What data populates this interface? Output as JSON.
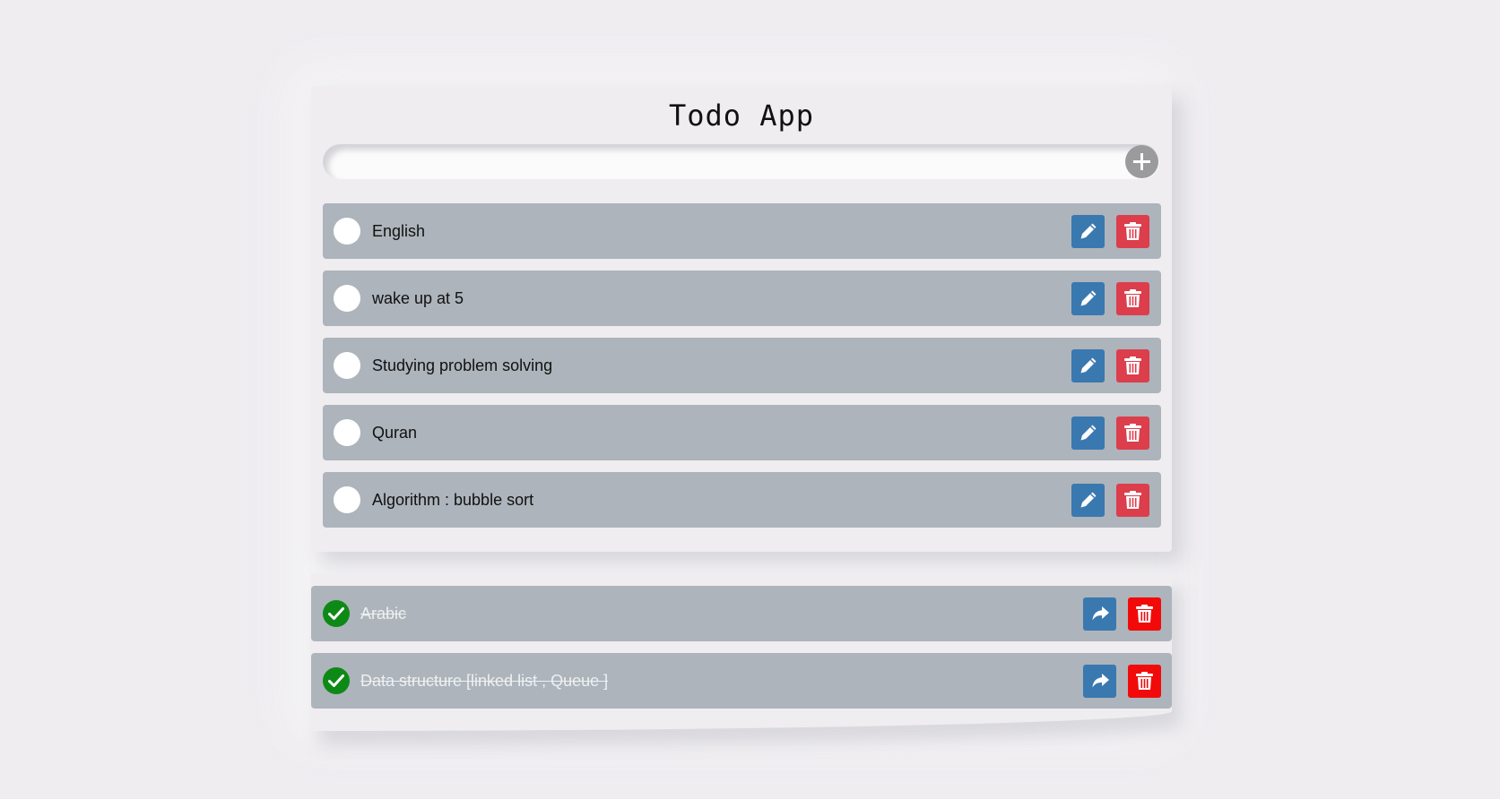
{
  "app": {
    "title": "Todo App"
  },
  "add_bar": {
    "input_value": "",
    "placeholder": "",
    "add_icon": "plus-icon"
  },
  "todos": [
    {
      "label": "English",
      "completed": false
    },
    {
      "label": "wake up at 5",
      "completed": false
    },
    {
      "label": "Studying problem solving",
      "completed": false
    },
    {
      "label": "Quran",
      "completed": false
    },
    {
      "label": "Algorithm : bubble sort",
      "completed": false
    }
  ],
  "completed_todos": [
    {
      "label": "Arabic",
      "completed": true
    },
    {
      "label": "Data structure [linked list , Queue ]",
      "completed": true
    }
  ],
  "icons": {
    "todo_status": "circle-icon",
    "edit": "pencil-icon",
    "delete": "trash-icon",
    "done_status": "check-circle-icon",
    "restore": "share-arrow-icon"
  },
  "colors": {
    "background": "#efedf0",
    "row": "#adb4bb",
    "edit_button": "#3a78b0",
    "delete_button": "#dc3e4c",
    "delete_button_done": "#f20a0a",
    "check": "#0d8a16"
  }
}
